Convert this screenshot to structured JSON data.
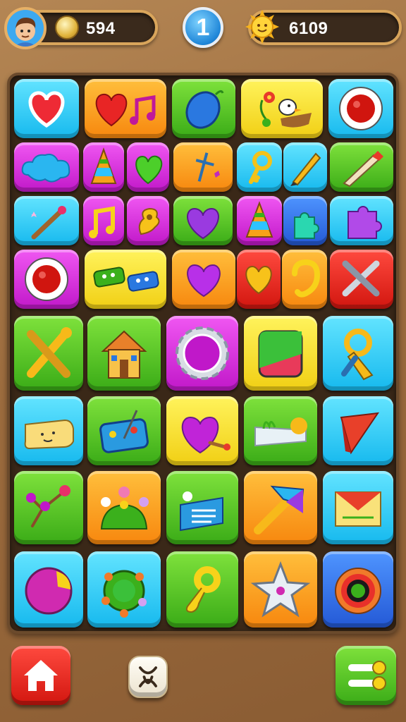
{
  "hud": {
    "coins": "594",
    "level": "1",
    "score": "6109"
  },
  "board": {
    "rows": [
      [
        "heart-icon",
        "heart-music-icon",
        "balloon-icon",
        "flower-duck-icon",
        "record-icon"
      ],
      [
        "cloud-icon",
        "cone-icon",
        "leaf-heart-icon",
        "cross-icon",
        "key-icon",
        "pencil-icon",
        "brush-icon"
      ],
      [
        "wand-icon",
        "music-note-icon",
        "puzzle-swirl-icon",
        "heart-icon",
        "cone-icon",
        "puzzle-piece-icon",
        "puzzle-piece-icon"
      ],
      [
        "record-icon",
        "game-controller-icon",
        "heart-icon",
        "heart-icon",
        "swirl-icon",
        "crossed-tools-icon"
      ],
      [
        "crossed-tools-icon",
        "house-icon",
        "gear-icon",
        "box-icon",
        "whistle-icon"
      ],
      [
        "paper-icon",
        "paint-palette-icon",
        "heart-brush-icon",
        "landscape-icon",
        "kite-icon"
      ],
      [
        "branch-icon",
        "garden-icon",
        "book-icon",
        "hammer-icon",
        "envelope-icon"
      ],
      [
        "ball-icon",
        "wreath-icon",
        "key-ring-icon",
        "star-icon",
        "target-icon"
      ]
    ]
  },
  "colors": {
    "background": "#9c6c3e",
    "board": "#3a2818",
    "accent": "#d9a55b"
  },
  "bottom": {
    "home": "home-icon",
    "center": "knot-icon",
    "menu": "menu-icon"
  }
}
